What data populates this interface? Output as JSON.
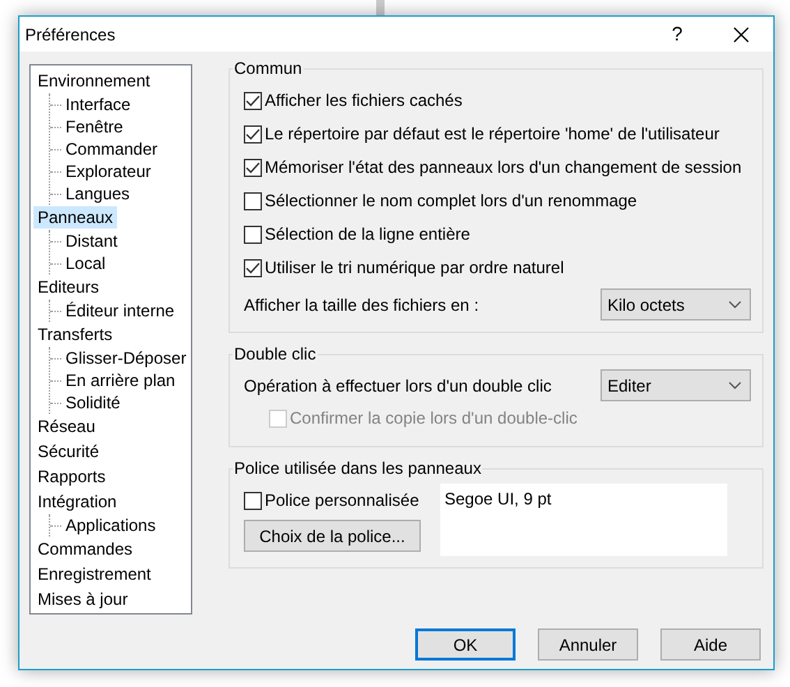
{
  "window": {
    "title": "Préférences",
    "help": "?"
  },
  "tree": [
    {
      "label": "Environnement",
      "selected": false,
      "children": [
        {
          "label": "Interface",
          "selected": false
        },
        {
          "label": "Fenêtre",
          "selected": false
        },
        {
          "label": "Commander",
          "selected": false
        },
        {
          "label": "Explorateur",
          "selected": false
        },
        {
          "label": "Langues",
          "selected": false
        }
      ]
    },
    {
      "label": "Panneaux",
      "selected": true,
      "children": [
        {
          "label": "Distant",
          "selected": false
        },
        {
          "label": "Local",
          "selected": false
        }
      ]
    },
    {
      "label": "Editeurs",
      "selected": false,
      "children": [
        {
          "label": "Éditeur interne",
          "selected": false
        }
      ]
    },
    {
      "label": "Transferts",
      "selected": false,
      "children": [
        {
          "label": "Glisser-Déposer",
          "selected": false
        },
        {
          "label": "En arrière plan",
          "selected": false
        },
        {
          "label": "Solidité",
          "selected": false
        }
      ]
    },
    {
      "label": "Réseau",
      "selected": false
    },
    {
      "label": "Sécurité",
      "selected": false
    },
    {
      "label": "Rapports",
      "selected": false
    },
    {
      "label": "Intégration",
      "selected": false,
      "children": [
        {
          "label": "Applications",
          "selected": false
        }
      ]
    },
    {
      "label": "Commandes",
      "selected": false
    },
    {
      "label": "Enregistrement",
      "selected": false
    },
    {
      "label": "Mises à jour",
      "selected": false
    }
  ],
  "commun": {
    "title": "Commun",
    "options": [
      {
        "label": "Afficher les fichiers cachés",
        "checked": true
      },
      {
        "label": "Le répertoire par défaut est le répertoire 'home' de l'utilisateur",
        "checked": true
      },
      {
        "label": "Mémoriser l'état des panneaux lors d'un changement de session",
        "checked": true
      },
      {
        "label": "Sélectionner le nom complet lors d'un renommage",
        "checked": false
      },
      {
        "label": "Sélection de la ligne entière",
        "checked": false
      },
      {
        "label": "Utiliser le tri numérique par ordre naturel",
        "checked": true
      }
    ],
    "size_label": "Afficher la taille des fichiers en :",
    "size_value": "Kilo octets"
  },
  "double_clic": {
    "title": "Double clic",
    "label": "Opération à effectuer lors d'un double clic",
    "value": "Editer",
    "confirm": {
      "label": "Confirmer la copie lors d'un double-clic",
      "checked": false,
      "disabled": true
    }
  },
  "police": {
    "title": "Police utilisée dans les panneaux",
    "custom": {
      "label": "Police personnalisée",
      "checked": false
    },
    "button": "Choix de la police...",
    "preview": "Segoe UI, 9 pt"
  },
  "buttons": [
    {
      "label": "OK",
      "default": true
    },
    {
      "label": "Annuler",
      "default": false
    },
    {
      "label": "Aide",
      "default": false
    }
  ]
}
